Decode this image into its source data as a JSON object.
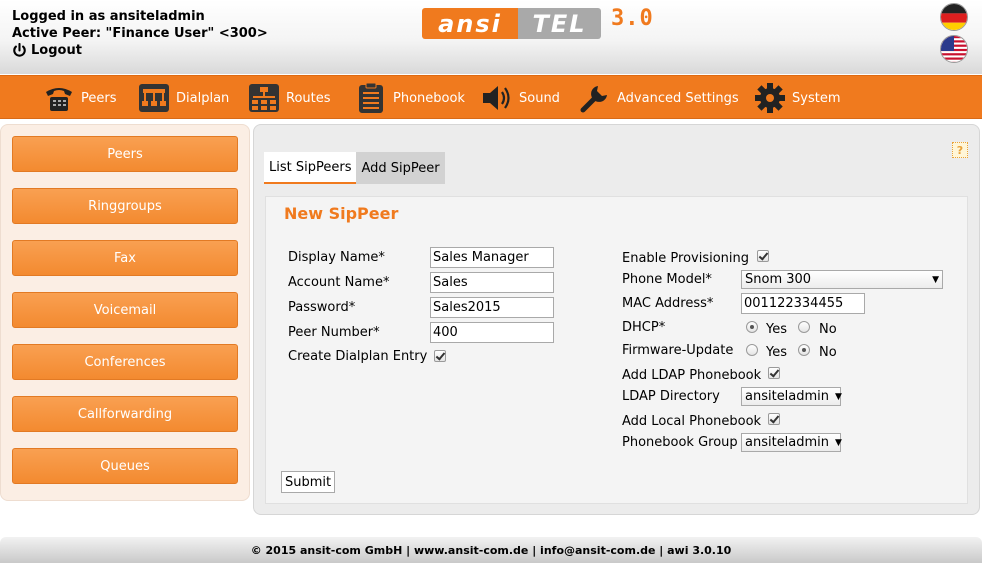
{
  "header": {
    "logged_in_text": "Logged in as ansiteladmin",
    "active_peer_text": "Active Peer: \"Finance User\" <300>",
    "logout_label": "Logout",
    "logo_left": "ansi",
    "logo_right": "TEL",
    "logo_version": "3.0",
    "flags": [
      "german-flag-icon",
      "us-flag-icon"
    ]
  },
  "nav": {
    "items": [
      {
        "label": "Peers",
        "icon": "telephone-icon"
      },
      {
        "label": "Dialplan",
        "icon": "dialplan-icon"
      },
      {
        "label": "Routes",
        "icon": "routes-icon"
      },
      {
        "label": "Phonebook",
        "icon": "phonebook-icon"
      },
      {
        "label": "Sound",
        "icon": "speaker-icon"
      },
      {
        "label": "Advanced Settings",
        "icon": "wrench-icon"
      },
      {
        "label": "System",
        "icon": "gear-icon"
      }
    ]
  },
  "sidebar": {
    "items": [
      "Peers",
      "Ringgroups",
      "Fax",
      "Voicemail",
      "Conferences",
      "Callforwarding",
      "Queues"
    ]
  },
  "main": {
    "tabs": [
      "List SipPeers",
      "Add SipPeer"
    ],
    "active_tab": "Add SipPeer",
    "title": "New SipPeer",
    "help_icon": "?",
    "form_left": {
      "display_name_label": "Display Name*",
      "display_name_value": "Sales Manager",
      "account_name_label": "Account Name*",
      "account_name_value": "Sales",
      "password_label": "Password*",
      "password_value": "Sales2015",
      "peer_number_label": "Peer Number*",
      "peer_number_value": "400",
      "create_dialplan_label": "Create Dialplan Entry",
      "create_dialplan_checked": true
    },
    "form_right": {
      "enable_provisioning_label": "Enable Provisioning",
      "enable_provisioning_checked": true,
      "phone_model_label": "Phone Model*",
      "phone_model_value": "Snom 300",
      "mac_address_label": "MAC Address*",
      "mac_address_value": "001122334455",
      "dhcp_label": "DHCP*",
      "dhcp_yes": "Yes",
      "dhcp_no": "No",
      "dhcp_selected": "Yes",
      "firmware_label": "Firmware-Update",
      "firmware_yes": "Yes",
      "firmware_no": "No",
      "firmware_selected": "No",
      "add_ldap_label": "Add LDAP Phonebook",
      "add_ldap_checked": true,
      "ldap_directory_label": "LDAP Directory",
      "ldap_directory_value": "ansiteladmin",
      "add_local_label": "Add Local Phonebook",
      "add_local_checked": true,
      "phonebook_group_label": "Phonebook Group",
      "phonebook_group_value": "ansiteladmin"
    },
    "submit_label": "Submit"
  },
  "footer": {
    "text": "© 2015 ansit-com GmbH | www.ansit-com.de | info@ansit-com.de | awi 3.0.10"
  },
  "colors": {
    "accent": "#f07a1e",
    "sidebar_bg": "#fbeee4",
    "main_bg": "#ececec"
  }
}
